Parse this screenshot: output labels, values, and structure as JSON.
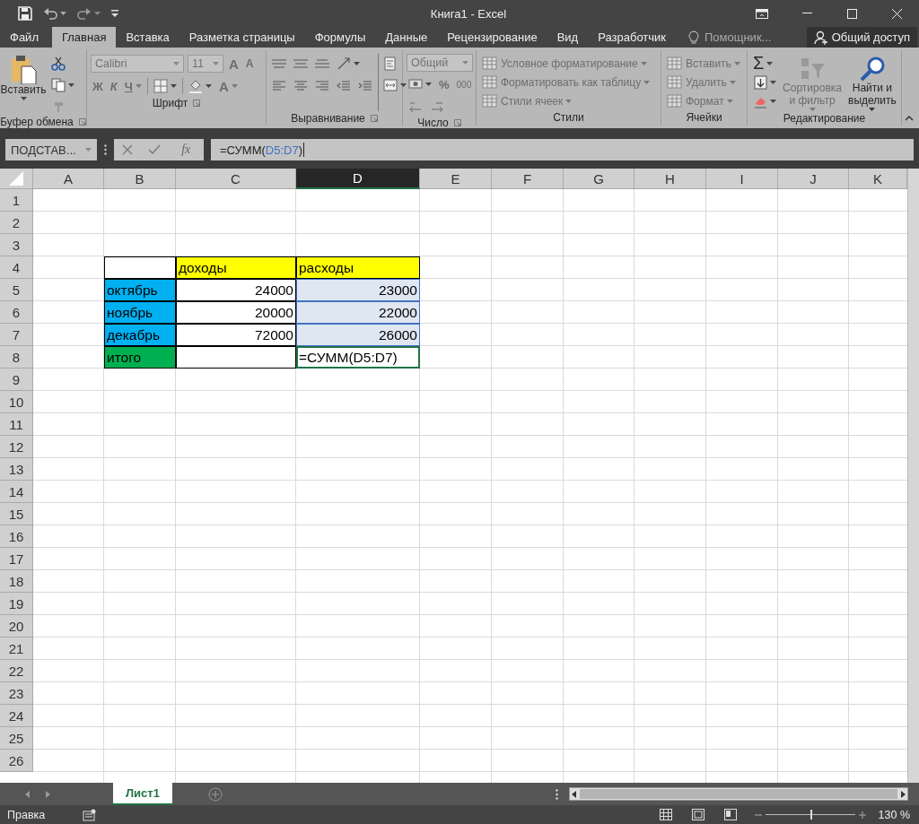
{
  "window": {
    "title": "Книга1 - Excel"
  },
  "ribbon_tabs": [
    {
      "label": "Файл",
      "selected": false
    },
    {
      "label": "Главная",
      "selected": true
    },
    {
      "label": "Вставка",
      "selected": false
    },
    {
      "label": "Разметка страницы",
      "selected": false
    },
    {
      "label": "Формулы",
      "selected": false
    },
    {
      "label": "Данные",
      "selected": false
    },
    {
      "label": "Рецензирование",
      "selected": false
    },
    {
      "label": "Вид",
      "selected": false
    },
    {
      "label": "Разработчик",
      "selected": false
    }
  ],
  "tell_me": {
    "placeholder": "Помощник..."
  },
  "share_button": "Общий доступ",
  "ribbon": {
    "clipboard": {
      "label": "Буфер обмена",
      "paste": "Вставить"
    },
    "font": {
      "label": "Шрифт",
      "font_name": "Calibri",
      "font_size": "11",
      "grow": "A",
      "shrink": "A",
      "bold": "Ж",
      "italic": "К",
      "underline": "Ч",
      "font_color": "A"
    },
    "alignment": {
      "label": "Выравнивание"
    },
    "number": {
      "label": "Число",
      "format": "Общий",
      "percent": "%",
      "thousands": "000"
    },
    "styles": {
      "label": "Стили",
      "items": [
        {
          "label": "Условное форматирование",
          "disabled": true
        },
        {
          "label": "Форматировать как таблицу",
          "disabled": true
        },
        {
          "label": "Стили ячеек",
          "disabled": true
        }
      ]
    },
    "cells": {
      "label": "Ячейки",
      "items": [
        {
          "label": "Вставить",
          "disabled": true
        },
        {
          "label": "Удалить",
          "disabled": true
        },
        {
          "label": "Формат",
          "disabled": true
        }
      ]
    },
    "editing": {
      "label": "Редактирование",
      "sum": "Σ",
      "buttons": [
        {
          "label": "Сортировка и фильтр",
          "disabled": true
        },
        {
          "label": "Найти и выделить",
          "disabled": false
        }
      ]
    }
  },
  "formula_bar": {
    "name_box": "ПОДСТАВ...",
    "insert_function": "fx",
    "formula": [
      {
        "text": "=СУММ("
      },
      {
        "text": "D5:D7",
        "kind": "reference"
      },
      {
        "text": ")"
      }
    ]
  },
  "sheet": {
    "columns": [
      {
        "label": "A",
        "selected": false
      },
      {
        "label": "B",
        "selected": false
      },
      {
        "label": "C",
        "selected": false
      },
      {
        "label": "D",
        "selected": true
      },
      {
        "label": "E",
        "selected": false
      },
      {
        "label": "F",
        "selected": false
      },
      {
        "label": "G",
        "selected": false
      },
      {
        "label": "H",
        "selected": false
      },
      {
        "label": "I",
        "selected": false
      },
      {
        "label": "J",
        "selected": false
      },
      {
        "label": "K",
        "selected": false
      }
    ],
    "rows": [
      {
        "header": "1"
      },
      {
        "header": "2"
      },
      {
        "header": "3"
      },
      {
        "header": "4",
        "cells": [
          {
            "color": "#ffffff",
            "bordered": true
          },
          {
            "text": "доходы",
            "kind": "text",
            "color": "#ffff00",
            "bordered": true
          },
          {
            "text": "расходы",
            "kind": "text",
            "color": "#ffff00",
            "bordered": true
          }
        ]
      },
      {
        "header": "5",
        "cells": [
          {
            "text": "октябрь",
            "kind": "text",
            "color": "#00b0f0",
            "bordered": true
          },
          {
            "text": "24000",
            "kind": "number",
            "bordered": true
          },
          {
            "text": "23000",
            "kind": "number",
            "bordered": true,
            "highlighted": true
          }
        ]
      },
      {
        "header": "6",
        "cells": [
          {
            "text": "ноябрь",
            "kind": "text",
            "color": "#00b0f0",
            "bordered": true
          },
          {
            "text": "20000",
            "kind": "number",
            "bordered": true
          },
          {
            "text": "22000",
            "kind": "number",
            "bordered": true,
            "highlighted": true
          }
        ]
      },
      {
        "header": "7",
        "cells": [
          {
            "text": "декабрь",
            "kind": "text",
            "color": "#00b0f0",
            "bordered": true
          },
          {
            "text": "72000",
            "kind": "number",
            "bordered": true
          },
          {
            "text": "26000",
            "kind": "number",
            "bordered": true,
            "highlighted": true
          }
        ]
      },
      {
        "header": "8",
        "cells": [
          {
            "text": "итого",
            "kind": "text",
            "color": "#00b050",
            "bordered": true
          },
          {
            "bordered": true
          },
          {
            "text": "=СУММ(D5:D7)",
            "kind": "text",
            "bordered": true,
            "editing": true
          }
        ]
      },
      {
        "header": "9"
      },
      {
        "header": "10"
      },
      {
        "header": "11"
      },
      {
        "header": "12"
      },
      {
        "header": "13"
      },
      {
        "header": "14"
      },
      {
        "header": "15"
      },
      {
        "header": "16"
      },
      {
        "header": "17"
      },
      {
        "header": "18"
      },
      {
        "header": "19"
      },
      {
        "header": "20"
      },
      {
        "header": "21"
      },
      {
        "header": "22"
      },
      {
        "header": "23"
      },
      {
        "header": "24"
      },
      {
        "header": "25"
      },
      {
        "header": "26"
      }
    ]
  },
  "sheet_tabs": [
    {
      "label": "Лист1",
      "selected": true
    }
  ],
  "status_bar": {
    "mode": "Правка",
    "zoom": {
      "level": 0.5,
      "reading": "130 %"
    }
  }
}
